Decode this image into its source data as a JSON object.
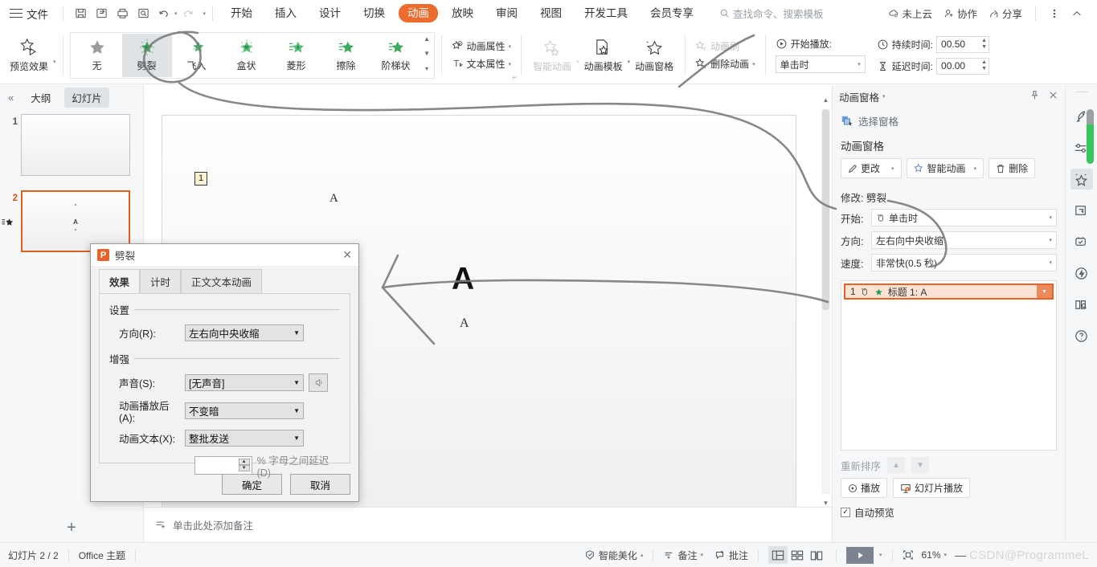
{
  "menubar": {
    "file_label": "文件",
    "quick_icons": [
      "save-icon",
      "save-as-icon",
      "print-icon",
      "print-preview-icon",
      "undo-icon",
      "redo-icon",
      "customize-icon"
    ],
    "tabs": [
      {
        "label": "开始",
        "active": false
      },
      {
        "label": "插入",
        "active": false
      },
      {
        "label": "设计",
        "active": false
      },
      {
        "label": "切换",
        "active": false
      },
      {
        "label": "动画",
        "active": true
      },
      {
        "label": "放映",
        "active": false
      },
      {
        "label": "审阅",
        "active": false
      },
      {
        "label": "视图",
        "active": false
      },
      {
        "label": "开发工具",
        "active": false
      },
      {
        "label": "会员专享",
        "active": false
      }
    ],
    "search_placeholder": "查找命令、搜索模板",
    "cloud_label": "未上云",
    "collab_label": "协作",
    "share_label": "分享",
    "accent_color": "#ec6b2d"
  },
  "ribbon": {
    "preview_label": "预览效果",
    "gallery": [
      {
        "label": "无",
        "selected": false
      },
      {
        "label": "劈裂",
        "selected": true
      },
      {
        "label": "飞入",
        "selected": false
      },
      {
        "label": "盒状",
        "selected": false
      },
      {
        "label": "菱形",
        "selected": false
      },
      {
        "label": "擦除",
        "selected": false
      },
      {
        "label": "阶梯状",
        "selected": false
      }
    ],
    "anim_property_label": "动画属性",
    "text_property_label": "文本属性",
    "smart_anim_label": "智能动画",
    "anim_template_label": "动画模板",
    "anim_pane_label": "动画窗格",
    "anim_brush_label": "动画刷",
    "delete_anim_label": "删除动画",
    "start_play_label": "开始播放:",
    "start_play_value": "单击时",
    "duration_label": "持续时间:",
    "duration_value": "00.50",
    "delay_label": "延迟时间:",
    "delay_value": "00.00"
  },
  "thumbpane": {
    "outline_tab": "大纲",
    "slides_tab": "幻灯片",
    "slides": [
      {
        "number": "1",
        "selected": false,
        "has_anim": false,
        "text": ""
      },
      {
        "number": "2",
        "selected": true,
        "has_anim": true,
        "text": "A"
      }
    ],
    "add_label": "+"
  },
  "slide": {
    "placeholder_number": "1",
    "text_small_top": "A",
    "text_big": "A",
    "text_small_bottom": "A"
  },
  "notes": {
    "placeholder": "单击此处添加备注"
  },
  "animpane": {
    "title": "动画窗格",
    "select_pane_label": "选择窗格",
    "header": "动画窗格",
    "modify_btn": "更改",
    "smart_anim_btn": "智能动画",
    "delete_btn": "删除",
    "modify_label": "修改: 劈裂",
    "fields": [
      {
        "label": "开始:",
        "value": "单击时",
        "has_mouse_icon": true
      },
      {
        "label": "方向:",
        "value": "左右向中央收缩",
        "has_mouse_icon": false
      },
      {
        "label": "速度:",
        "value": "非常快(0.5 秒)",
        "has_mouse_icon": false
      }
    ],
    "items": [
      {
        "index": "1",
        "label": "标题 1: A"
      }
    ],
    "reorder_label": "重新排序",
    "play_btn": "播放",
    "slideshow_btn": "幻灯片播放",
    "autopreview_label": "自动预览",
    "autopreview_checked": true,
    "highlight_color": "#e8622a"
  },
  "strip": {
    "icons": [
      "rocket-icon",
      "sliders-icon",
      "animation-star-icon",
      "duplicate-icon",
      "cloud-tools-icon",
      "lightning-icon",
      "book-search-icon",
      "help-icon"
    ],
    "selected": "animation-star-icon"
  },
  "dialog": {
    "title": "劈裂",
    "logo_letter": "P",
    "tabs": [
      {
        "label": "效果",
        "active": true
      },
      {
        "label": "计时",
        "active": false
      },
      {
        "label": "正文文本动画",
        "active": false
      }
    ],
    "group_settings": "设置",
    "group_enhance": "增强",
    "direction_label": "方向(R):",
    "direction_value": "左右向中央收缩",
    "sound_label": "声音(S):",
    "sound_value": "[无声音]",
    "after_anim_label": "动画播放后(A):",
    "after_anim_value": "不变暗",
    "anim_text_label": "动画文本(X):",
    "anim_text_value": "整批发送",
    "delay_percent_value": "",
    "delay_percent_label": "% 字母之间延迟(D)",
    "ok_btn": "确定",
    "cancel_btn": "取消"
  },
  "statusbar": {
    "slide_count": "幻灯片 2 / 2",
    "theme": "Office 主题",
    "beautify_label": "智能美化",
    "notes_label": "备注",
    "comment_label": "批注",
    "view_icons": [
      "normal-view-icon",
      "sorter-view-icon",
      "reading-view-icon"
    ],
    "zoom_value": "61%",
    "watermark": "CSDN@ProgrammeL"
  }
}
